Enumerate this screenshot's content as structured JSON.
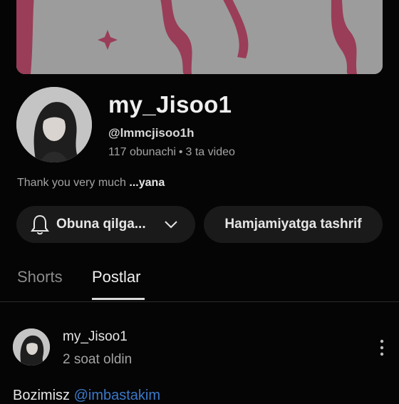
{
  "channel": {
    "name": "my_Jisoo1",
    "handle": "@lmmcjisoo1h",
    "subscribers": "117 obunachi",
    "separator": "•",
    "videos": "3 ta video",
    "description_text": "Thank you very much",
    "description_more": "...yana"
  },
  "actions": {
    "subscribe_label": "Obuna qilga...",
    "community_label": "Hamjamiyatga tashrif"
  },
  "tabs": [
    {
      "label": "Shorts",
      "active": false
    },
    {
      "label": "Postlar",
      "active": true
    }
  ],
  "post": {
    "author": "my_Jisoo1",
    "time": "2 soat oldin",
    "text": "Bozimisz ",
    "mention": "@imbastakim"
  },
  "icons": {
    "subscribe": "bell-icon",
    "dropdown": "chevron-down-icon",
    "menu": "more-vert-icon"
  },
  "colors": {
    "background": "#050505",
    "pill": "#1a1a1a",
    "link": "#3b79c9",
    "banner_pattern": "#b0566e"
  }
}
